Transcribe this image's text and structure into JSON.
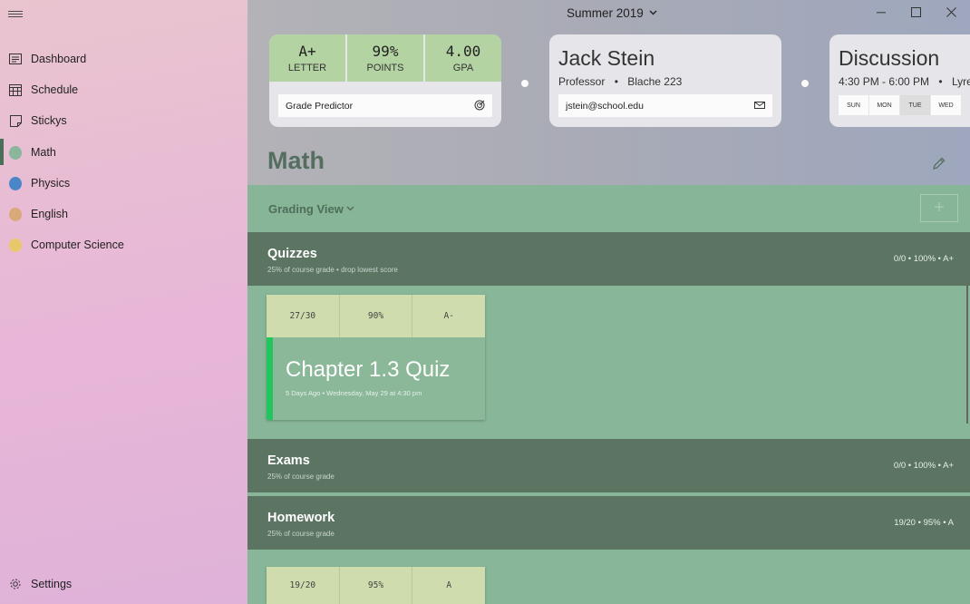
{
  "sidebar": {
    "menu_icon": "hamburger-icon",
    "items": [
      {
        "label": "Dashboard",
        "icon": "dashboard-icon"
      },
      {
        "label": "Schedule",
        "icon": "calendar-icon"
      },
      {
        "label": "Stickys",
        "icon": "sticky-note-icon"
      },
      {
        "label": "Math",
        "color": "#8ab79b",
        "active": true
      },
      {
        "label": "Physics",
        "color": "#4a86c8"
      },
      {
        "label": "English",
        "color": "#d9a97a"
      },
      {
        "label": "Computer Science",
        "color": "#e8c86a"
      }
    ],
    "settings_label": "Settings"
  },
  "header": {
    "term": "Summer 2019",
    "grade_card": {
      "cells": [
        {
          "value": "A+",
          "label": "LETTER"
        },
        {
          "value": "99%",
          "label": "POINTS"
        },
        {
          "value": "4.00",
          "label": "GPA"
        }
      ],
      "predictor_label": "Grade Predictor"
    },
    "professor_card": {
      "name": "Jack Stein",
      "role": "Professor",
      "office": "Blache 223",
      "email": "jstein@school.edu"
    },
    "discussion_card": {
      "title": "Discussion",
      "time": "4:30 PM - 6:00 PM",
      "location": "Lyre",
      "days": [
        "SUN",
        "MON",
        "TUE",
        "WED"
      ],
      "selected_day": "TUE"
    }
  },
  "course": {
    "title": "Math",
    "view_label": "Grading View",
    "add_label": "+"
  },
  "categories": [
    {
      "title": "Quizzes",
      "subtitle": "25% of course grade • drop lowest score",
      "stats": "0/0 • 100% • A+"
    },
    {
      "title": "Exams",
      "subtitle": "25% of course grade",
      "stats": "0/0 • 100% • A+"
    },
    {
      "title": "Homework",
      "subtitle": "25% of course grade",
      "stats": "19/20 • 95% • A"
    }
  ],
  "assignments": {
    "quiz": {
      "score": "27/30",
      "percent": "90%",
      "letter": "A-",
      "title": "Chapter 1.3 Quiz",
      "subtitle": "5 Days Ago • Wednesday, May 29 at 4:30 pm",
      "accent_color": "#22c55e"
    },
    "homework": {
      "score": "19/20",
      "percent": "95%",
      "letter": "A"
    }
  },
  "colors": {
    "course_green": "#8ab79b",
    "category_header": "#5c7563",
    "grade_cell": "#b4d3a2"
  }
}
